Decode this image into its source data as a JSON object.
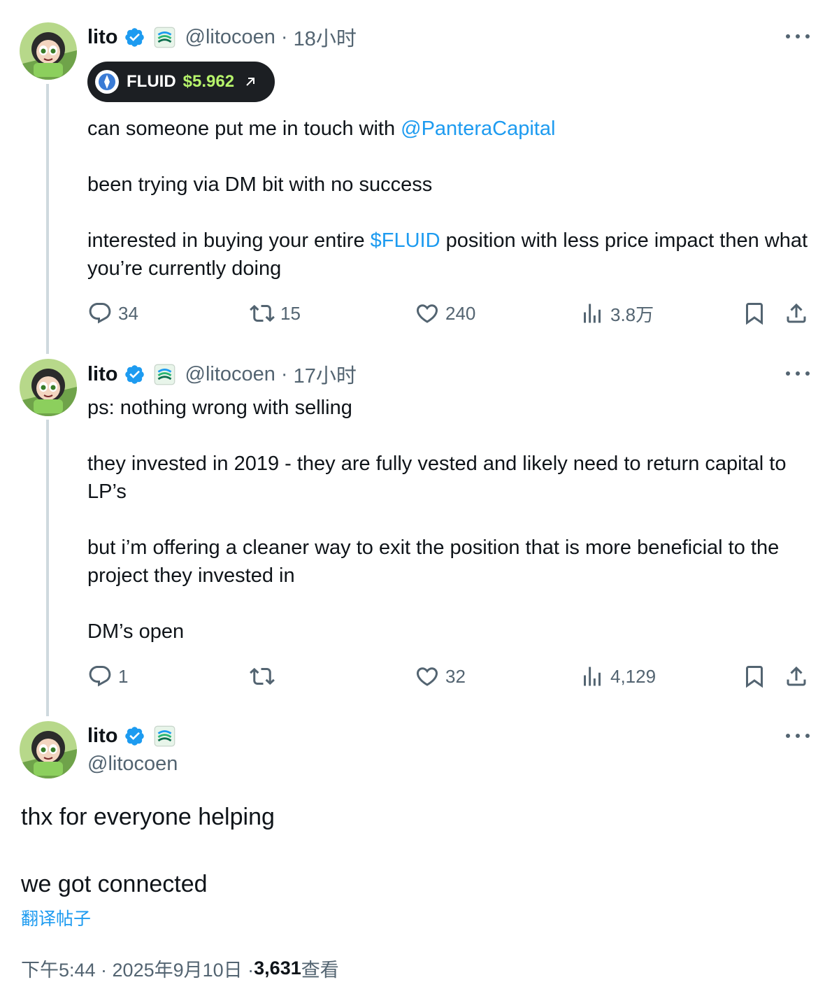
{
  "colors": {
    "accent": "#1d9bf0",
    "muted": "#536471",
    "price": "#b6f36b"
  },
  "posts": [
    {
      "name": "lito",
      "handle": "@litocoen",
      "time": "18小时",
      "ticker": {
        "symbol": "FLUID",
        "price": "$5.962"
      },
      "lines": {
        "l1_pre": "can someone put me in touch with ",
        "l1_mention": "@PanteraCapital",
        "l2": "been trying via DM bit with no success",
        "l3_pre": "interested in buying your entire ",
        "l3_cashtag": "$FLUID",
        "l3_post": " position with less price impact then what you’re currently doing"
      },
      "stats": {
        "replies": "34",
        "reposts": "15",
        "likes": "240",
        "views": "3.8万"
      }
    },
    {
      "name": "lito",
      "handle": "@litocoen",
      "time": "17小时",
      "lines": {
        "l1": "ps: nothing wrong with selling",
        "l2": "they invested in 2019 - they are fully vested and likely need to return capital to LP’s",
        "l3": "but i’m offering a cleaner way to exit the position that is more beneficial to the project they invested in",
        "l4": "DM’s open"
      },
      "stats": {
        "replies": "1",
        "reposts": "",
        "likes": "32",
        "views": "4,129"
      }
    }
  ],
  "main_post": {
    "name": "lito",
    "handle": "@litocoen",
    "line1": "thx for everyone helping",
    "line2": "we got connected",
    "translate": "翻译帖子",
    "timestamp": "下午5:44 · 2025年9月10日 · ",
    "views_count": "3,631",
    "views_label": " 查看"
  },
  "icons": [
    "verified-badge-icon",
    "affiliate-badge-icon",
    "more-icon",
    "reply-icon",
    "repost-icon",
    "like-icon",
    "views-icon",
    "bookmark-icon",
    "share-icon",
    "external-link-icon",
    "fluid-coin-icon"
  ]
}
